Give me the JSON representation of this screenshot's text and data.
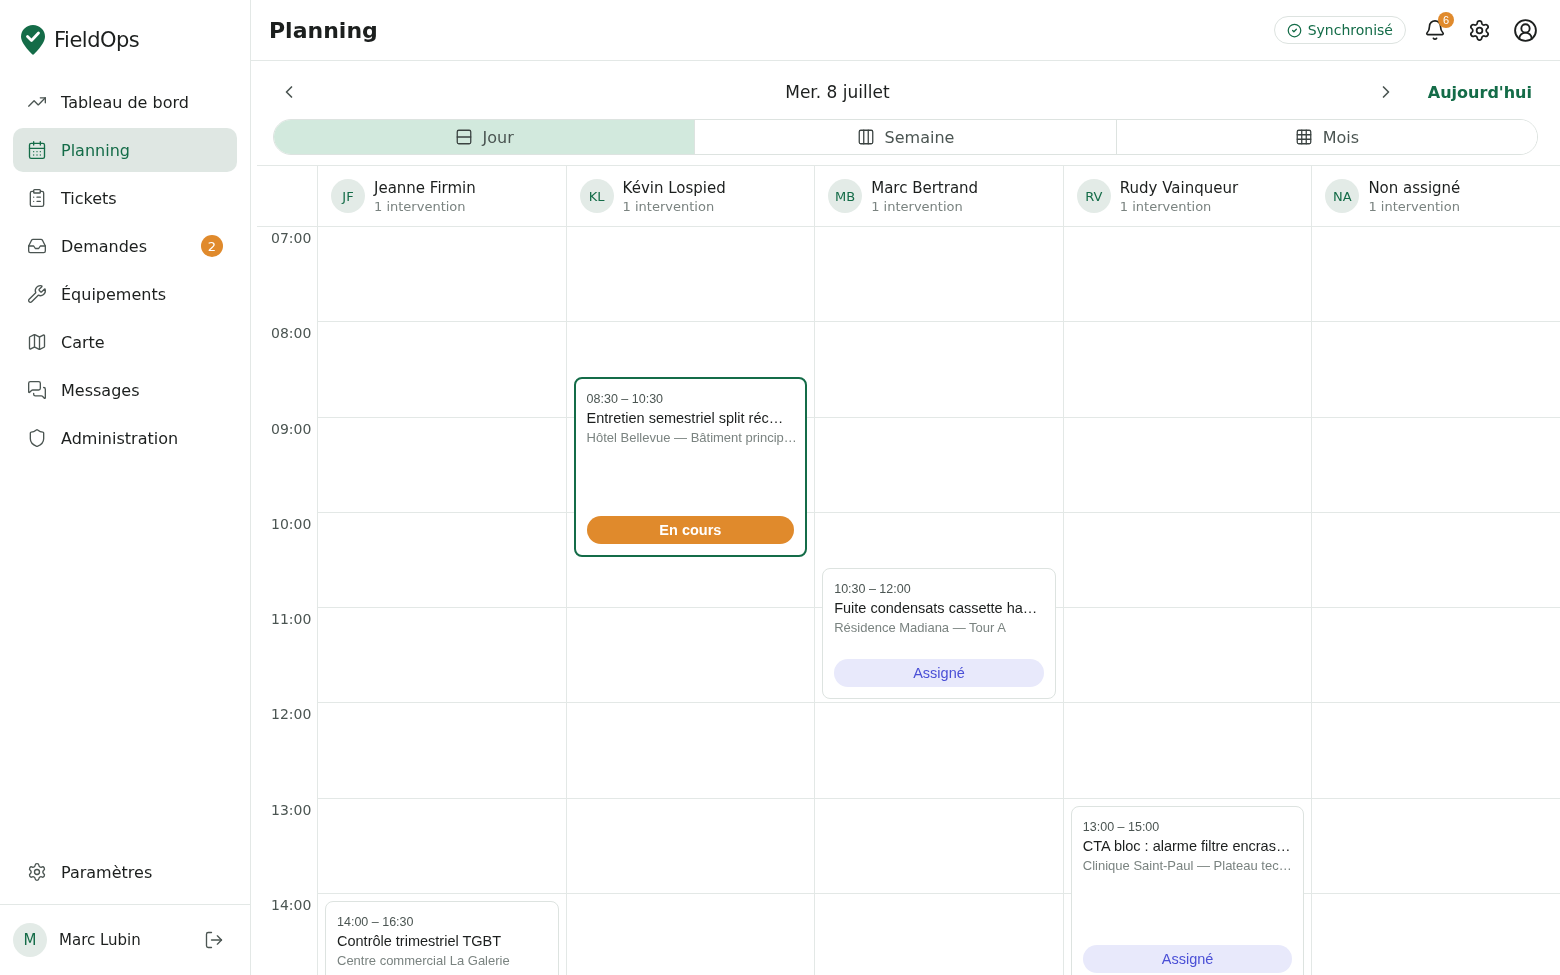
{
  "brand": {
    "name": "FieldOps"
  },
  "sidebar": {
    "items": [
      {
        "label": "Tableau de bord",
        "selected": false
      },
      {
        "label": "Planning",
        "selected": true
      },
      {
        "label": "Tickets",
        "selected": false
      },
      {
        "label": "Demandes",
        "selected": false,
        "badge": "2"
      },
      {
        "label": "Équipements",
        "selected": false
      },
      {
        "label": "Carte",
        "selected": false
      },
      {
        "label": "Messages",
        "selected": false
      },
      {
        "label": "Administration",
        "selected": false
      }
    ],
    "footer_item": {
      "label": "Paramètres",
      "selected": false
    },
    "user": {
      "initial": "M",
      "name": "Marc Lubin"
    }
  },
  "header": {
    "title": "Planning",
    "sync_status": "Synchronisé",
    "notification_count": "6"
  },
  "date_nav": {
    "date": "Mer. 8 juillet",
    "today": "Aujourd'hui"
  },
  "view_tabs": [
    {
      "label": "Jour",
      "selected": true
    },
    {
      "label": "Semaine",
      "selected": false
    },
    {
      "label": "Mois",
      "selected": false
    }
  ],
  "hours": [
    "07:00",
    "08:00",
    "09:00",
    "10:00",
    "11:00",
    "12:00",
    "13:00",
    "14:00"
  ],
  "technicians": [
    {
      "initials": "JF",
      "name": "Jeanne Firmin",
      "count": "1 intervention",
      "events": [
        {
          "time": "14:00 – 16:30",
          "title": "Contrôle trimestriel TGBT",
          "place": "Centre commercial La Galerie"
        }
      ]
    },
    {
      "initials": "KL",
      "name": "Kévin Lospied",
      "count": "1 intervention",
      "events": [
        {
          "time": "08:30 – 10:30",
          "title": "Entretien semestriel split réc…",
          "place": "Hôtel Bellevue — Bâtiment princip…",
          "status": {
            "kind": "in_progress",
            "label": "En cours"
          }
        }
      ]
    },
    {
      "initials": "MB",
      "name": "Marc Bertrand",
      "count": "1 intervention",
      "events": [
        {
          "time": "10:30 – 12:00",
          "title": "Fuite condensats cassette ha…",
          "place": "Résidence Madiana — Tour A",
          "status": {
            "kind": "assigned",
            "label": "Assigné"
          }
        }
      ]
    },
    {
      "initials": "RV",
      "name": "Rudy Vainqueur",
      "count": "1 intervention",
      "events": [
        {
          "time": "13:00 – 15:00",
          "title": "CTA bloc : alarme filtre encras…",
          "place": "Clinique Saint-Paul — Plateau tec…",
          "status": {
            "kind": "assigned",
            "label": "Assigné"
          }
        }
      ]
    },
    {
      "initials": "NA",
      "name": "Non assigné",
      "count": "1 intervention"
    }
  ]
}
